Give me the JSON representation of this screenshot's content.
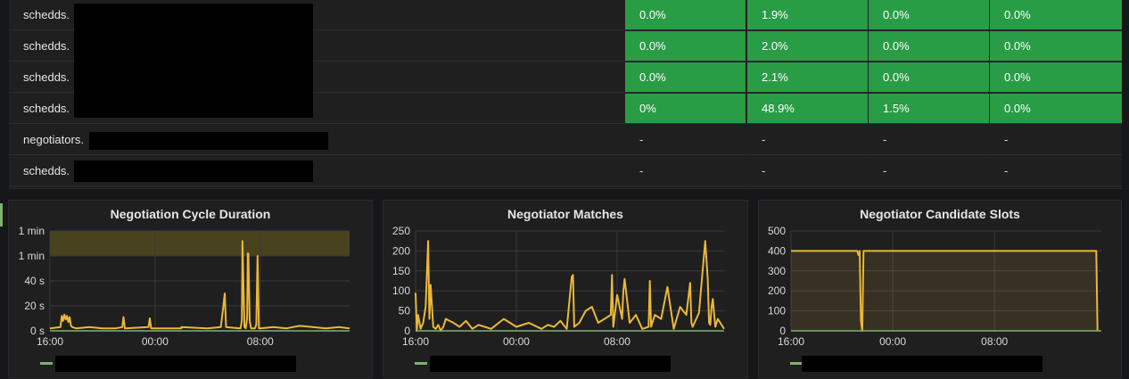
{
  "table": {
    "rows": [
      {
        "name": "schedds.",
        "values": [
          "0.0%",
          "1.9%",
          "0.0%",
          "0.0%"
        ],
        "status": "ok"
      },
      {
        "name": "schedds.",
        "values": [
          "0.0%",
          "2.0%",
          "0.0%",
          "0.0%"
        ],
        "status": "ok"
      },
      {
        "name": "schedds.",
        "values": [
          "0.0%",
          "2.1%",
          "0.0%",
          "0.0%"
        ],
        "status": "ok"
      },
      {
        "name": "schedds.",
        "values": [
          "0%",
          "48.9%",
          "1.5%",
          "0.0%"
        ],
        "status": "ok"
      },
      {
        "name": "negotiators.",
        "values": [
          "-",
          "-",
          "-",
          "-"
        ],
        "status": "na"
      },
      {
        "name": "schedds.",
        "values": [
          "-",
          "-",
          "-",
          "-"
        ],
        "status": "na"
      }
    ]
  },
  "colors": {
    "ok_cell": "#299c46",
    "series": "#eab839",
    "legend": "#7eb26d",
    "threshold_fill": "#504a1e"
  },
  "chart_data": [
    {
      "type": "line",
      "title": "Negotiation Cycle Duration",
      "y_tick_labels": [
        "0 s",
        "20 s",
        "40 s",
        "1 min",
        "1 min"
      ],
      "y_tick_values": [
        0,
        20,
        40,
        60,
        80
      ],
      "ylim": [
        0,
        80
      ],
      "threshold_band": [
        60,
        80
      ],
      "x_tick_labels": [
        "16:00",
        "00:00",
        "08:00"
      ],
      "x_tick_positions": [
        0,
        8,
        16
      ],
      "xlim": [
        0,
        22.8
      ],
      "grid": true,
      "series": [
        {
          "x": [
            0,
            0.8,
            0.9,
            1.0,
            1.1,
            1.2,
            1.3,
            1.4,
            1.5,
            1.6,
            1.7,
            2.0,
            3,
            4,
            5,
            5.5,
            5.6,
            5.7,
            7.5,
            7.6,
            7.7,
            10,
            10,
            12,
            13,
            13.2,
            13.3,
            13.4,
            14.5,
            14.6,
            14.65,
            14.7,
            14.8,
            14.9,
            15.0,
            15.05,
            15.1,
            15.2,
            15.3,
            15.6,
            15.7,
            15.8,
            15.9,
            16,
            17,
            18,
            19,
            20,
            21,
            22,
            22.8
          ],
          "y": [
            2,
            3,
            12,
            8,
            13,
            9,
            12,
            7,
            11,
            4,
            3,
            2,
            3,
            2,
            2,
            3,
            11,
            2,
            3,
            10,
            2,
            2,
            3,
            2,
            3,
            20,
            30,
            3,
            2,
            8,
            72,
            50,
            3,
            2,
            10,
            62,
            62,
            8,
            2,
            2,
            5,
            60,
            2,
            2,
            3,
            2,
            4,
            3,
            2,
            3,
            2
          ]
        }
      ]
    },
    {
      "type": "line",
      "title": "Negotiator Matches",
      "y_tick_labels": [
        "0",
        "50",
        "100",
        "150",
        "200",
        "250"
      ],
      "y_tick_values": [
        0,
        50,
        100,
        150,
        200,
        250
      ],
      "ylim": [
        0,
        250
      ],
      "x_tick_labels": [
        "16:00",
        "00:00",
        "08:00"
      ],
      "x_tick_positions": [
        0,
        8,
        16
      ],
      "xlim": [
        0,
        24.5
      ],
      "grid": true,
      "series": [
        {
          "x": [
            0,
            0.1,
            0.2,
            0.4,
            0.6,
            0.8,
            1.0,
            1.1,
            1.2,
            1.4,
            1.6,
            1.8,
            2.0,
            2.2,
            2.4,
            3,
            3.5,
            4,
            4.5,
            5,
            5.5,
            6,
            7,
            8,
            9,
            10,
            10.5,
            11,
            11.5,
            12,
            12.4,
            12.5,
            12.6,
            13,
            13.5,
            14,
            14.5,
            15,
            15.5,
            15.6,
            15.7,
            16,
            16.4,
            16.5,
            16.6,
            17,
            17.5,
            18,
            18.5,
            18.6,
            18.7,
            19,
            19.5,
            20,
            20.5,
            21,
            21.5,
            21.8,
            21.9,
            22,
            22.5,
            23,
            23.2,
            23.3,
            23.4,
            23.5,
            23.6,
            23.8,
            24,
            24.5
          ],
          "y": [
            95,
            0,
            40,
            5,
            20,
            60,
            225,
            30,
            115,
            10,
            5,
            15,
            0,
            10,
            30,
            20,
            10,
            25,
            5,
            15,
            10,
            5,
            30,
            10,
            20,
            5,
            15,
            10,
            25,
            5,
            135,
            140,
            10,
            20,
            50,
            60,
            20,
            30,
            40,
            140,
            10,
            90,
            30,
            100,
            130,
            20,
            40,
            5,
            10,
            125,
            10,
            40,
            30,
            110,
            5,
            60,
            40,
            120,
            20,
            10,
            45,
            225,
            130,
            20,
            15,
            60,
            80,
            10,
            30,
            5
          ]
        }
      ]
    },
    {
      "type": "area",
      "title": "Negotiator Candidate Slots",
      "y_tick_labels": [
        "0",
        "100",
        "200",
        "300",
        "400",
        "500"
      ],
      "y_tick_values": [
        0,
        100,
        200,
        300,
        400,
        500
      ],
      "ylim": [
        0,
        500
      ],
      "x_tick_labels": [
        "16:00",
        "00:00",
        "08:00"
      ],
      "x_tick_positions": [
        0,
        8,
        16
      ],
      "xlim": [
        0,
        24.4
      ],
      "grid": true,
      "series": [
        {
          "x": [
            0,
            5.2,
            5.3,
            5.4,
            5.5,
            5.6,
            5.7,
            23.9,
            24.0,
            24.1
          ],
          "y": [
            400,
            400,
            380,
            400,
            50,
            0,
            400,
            400,
            400,
            0
          ]
        }
      ]
    }
  ]
}
